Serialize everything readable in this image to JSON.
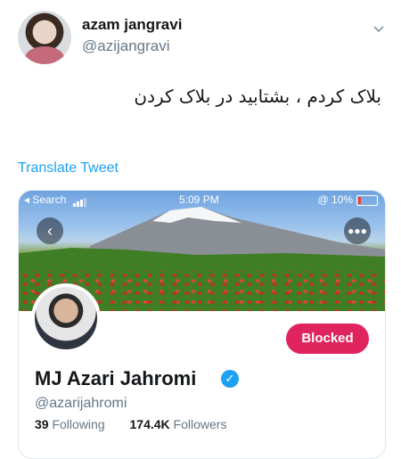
{
  "tweet": {
    "author_name": "azam jangravi",
    "author_handle": "@azijangravi",
    "text": "بلاک کردم ، بشتابید در بلاک کردن",
    "translate_label": "Translate Tweet"
  },
  "embedded_screenshot": {
    "status_bar": {
      "left": "◂ Search",
      "time": "5:09 PM",
      "battery": "@ 10%"
    },
    "profile": {
      "name": "MJ Azari Jahromi",
      "handle": "@azarijahromi",
      "following_count": "39",
      "following_label": "Following",
      "followers_count": "174.4K",
      "followers_label": "Followers",
      "blocked_label": "Blocked",
      "verified": true
    }
  },
  "colors": {
    "accent": "#1da1f2",
    "blocked": "#e0245e",
    "muted": "#657786"
  },
  "icons": {
    "caret": "chevron-down-icon",
    "back": "chevron-left-icon",
    "more": "more-dots-icon",
    "verified": "verified-badge-icon"
  }
}
